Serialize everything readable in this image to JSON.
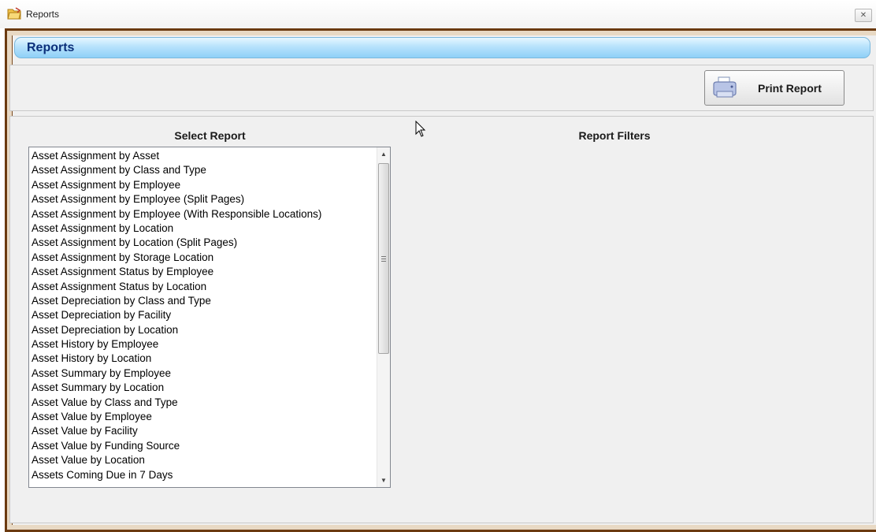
{
  "window": {
    "title": "Reports",
    "close_glyph": "✕"
  },
  "header": {
    "title": "Reports"
  },
  "toolbar": {
    "print_label": "Print Report"
  },
  "select_report": {
    "label": "Select Report",
    "items": [
      "Asset Assignment by Asset",
      "Asset Assignment by Class and Type",
      "Asset Assignment by Employee",
      "Asset Assignment by Employee (Split Pages)",
      "Asset Assignment by Employee (With Responsible Locations)",
      "Asset Assignment by Location",
      "Asset Assignment by Location (Split Pages)",
      "Asset Assignment by Storage Location",
      "Asset Assignment Status by Employee",
      "Asset Assignment Status by Location",
      "Asset Depreciation by Class and Type",
      "Asset Depreciation by Facility",
      "Asset Depreciation by Location",
      "Asset History by Employee",
      "Asset History by Location",
      "Asset Summary by Employee",
      "Asset Summary by Location",
      "Asset Value by Class and Type",
      "Asset Value by Employee",
      "Asset Value by Facility",
      "Asset Value by Funding Source",
      "Asset Value by Location",
      "Assets Coming Due in 7 Days"
    ],
    "scroll_up_glyph": "▲",
    "scroll_down_glyph": "▼"
  },
  "filters": {
    "label": "Report Filters"
  },
  "colors": {
    "frame": "#6b3a10",
    "header_gradient_end": "#8fd0f7",
    "header_text": "#0b2f7a"
  }
}
